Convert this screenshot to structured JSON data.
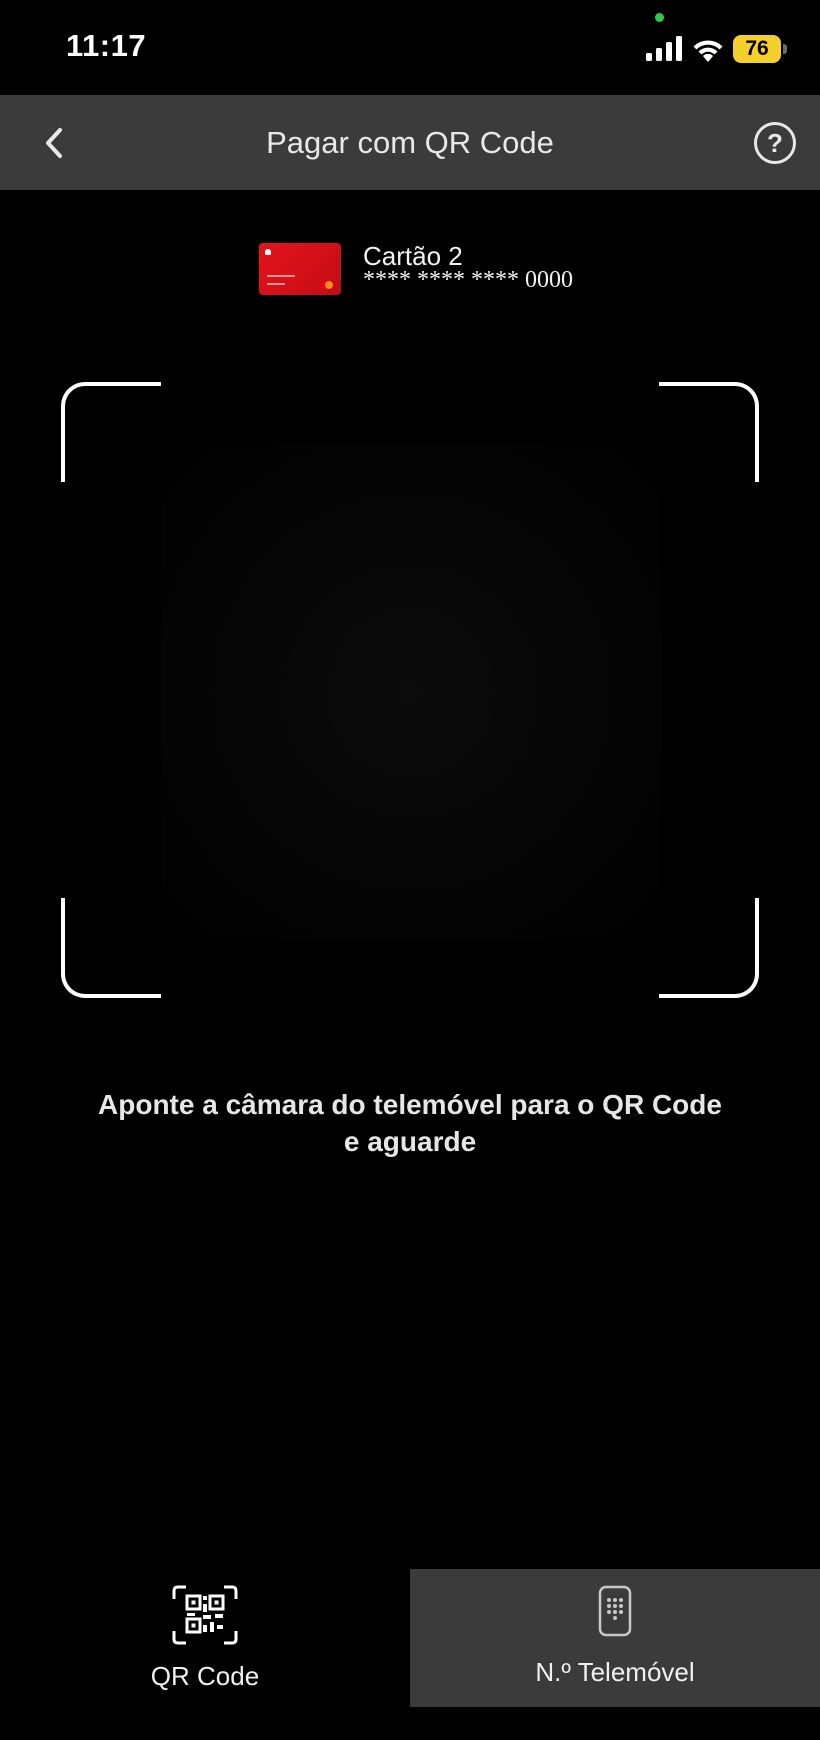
{
  "status_bar": {
    "time": "11:17",
    "battery": "76"
  },
  "header": {
    "title": "Pagar com QR Code"
  },
  "card": {
    "name": "Cartão 2",
    "number": "**** **** **** 0000"
  },
  "instruction": {
    "line1": "Aponte a câmara do telemóvel para o QR Code",
    "line2": "e aguarde"
  },
  "tabs": [
    {
      "label": "QR Code",
      "icon": "qr-code-icon",
      "selected": true
    },
    {
      "label": "N.º Telemóvel",
      "icon": "phone-keypad-icon",
      "selected": false
    }
  ],
  "colors": {
    "header_bg": "#3b3b3b",
    "card_red": "#e3141c",
    "battery": "#f5cf2a"
  }
}
